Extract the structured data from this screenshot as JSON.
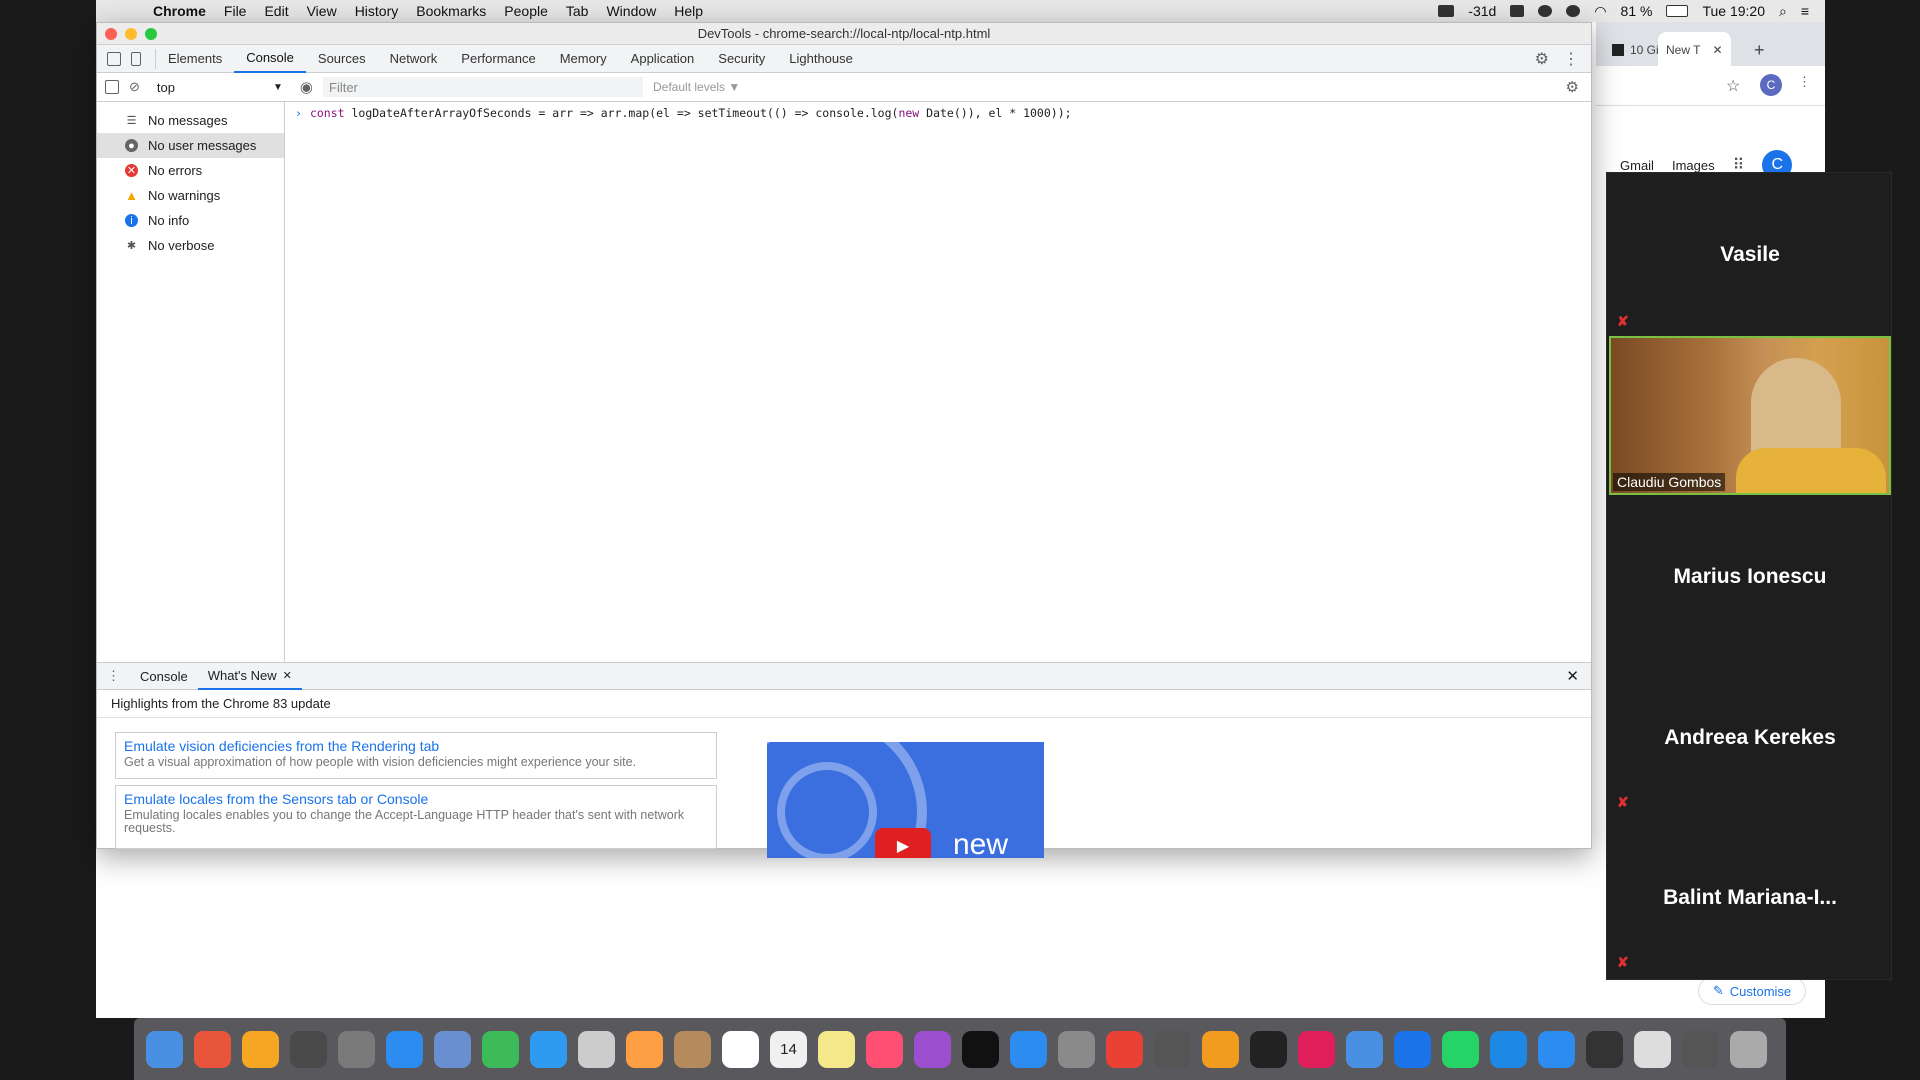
{
  "menubar": {
    "app": "Chrome",
    "items": [
      "File",
      "Edit",
      "View",
      "History",
      "Bookmarks",
      "People",
      "Tab",
      "Window",
      "Help"
    ],
    "battery_temp": "-31d",
    "battery": "81 %",
    "clock": "Tue 19:20"
  },
  "window": {
    "title": "DevTools - chrome-search://local-ntp/local-ntp.html"
  },
  "devtools": {
    "tabs": [
      "Elements",
      "Console",
      "Sources",
      "Network",
      "Performance",
      "Memory",
      "Application",
      "Security",
      "Lighthouse"
    ],
    "active_tab": "Console",
    "context": "top",
    "filter_placeholder": "Filter",
    "levels": "Default levels ▼",
    "sidebar": [
      {
        "label": "No messages",
        "icon": "list-icon"
      },
      {
        "label": "No user messages",
        "icon": "user-icon"
      },
      {
        "label": "No errors",
        "icon": "error-icon"
      },
      {
        "label": "No warnings",
        "icon": "warning-icon"
      },
      {
        "label": "No info",
        "icon": "info-icon"
      },
      {
        "label": "No verbose",
        "icon": "bug-icon"
      }
    ],
    "console_code": {
      "kw1": "const",
      "p1": " logDateAfterArrayOfSeconds = arr => arr.map(el => setTimeout(() => console.log(",
      "kw2": "new",
      "p2": " Date()), el * 1000));"
    },
    "drawer": {
      "tabs": [
        "Console",
        "What's New"
      ],
      "highlights": "Highlights from the Chrome 83 update",
      "cards": [
        {
          "title": "Emulate vision deficiencies from the Rendering tab",
          "desc": "Get a visual approximation of how people with vision deficiencies might experience your site."
        },
        {
          "title": "Emulate locales from the Sensors tab or Console",
          "desc": "Emulating locales enables you to change the Accept-Language HTTP header that's sent with network requests."
        }
      ],
      "video_text": "new"
    }
  },
  "chrome": {
    "tabs": [
      "10 Gi",
      "New T"
    ],
    "ntp_links": [
      "Gmail",
      "Images"
    ],
    "avatar": "C",
    "customise": "Customise"
  },
  "zoom": {
    "participants": [
      {
        "name": "Vasile",
        "muted": true
      },
      {
        "name": "Claudiu Gombos",
        "muted": false,
        "video": true
      },
      {
        "name": "Marius Ionescu",
        "muted": false
      },
      {
        "name": "Andreea Kerekes",
        "muted": true
      },
      {
        "name": "Balint  Mariana-I...",
        "muted": true
      }
    ]
  },
  "dock": {
    "date_badge": "14",
    "colors": [
      "#4a90e2",
      "#e8553a",
      "#f5a623",
      "#4a4a4a",
      "#7a7a7a",
      "#2d8cf0",
      "#6a8fd0",
      "#3dbb58",
      "#2e9bf0",
      "#cccccc",
      "#ff9f43",
      "#b58a5c",
      "#fff",
      "#f0f0f0",
      "#f5e88b",
      "#ff4f73",
      "#9b4fcf",
      "#111",
      "#2d8cf0",
      "#8a8a8a",
      "#e94235",
      "#555",
      "#f29c1f",
      "#222",
      "#e01e5a",
      "#4a90e2",
      "#1a73e8",
      "#25d366",
      "#1e88e5",
      "#2d8cf0",
      "#333",
      "#ddd",
      "#555",
      "#aaa"
    ]
  }
}
